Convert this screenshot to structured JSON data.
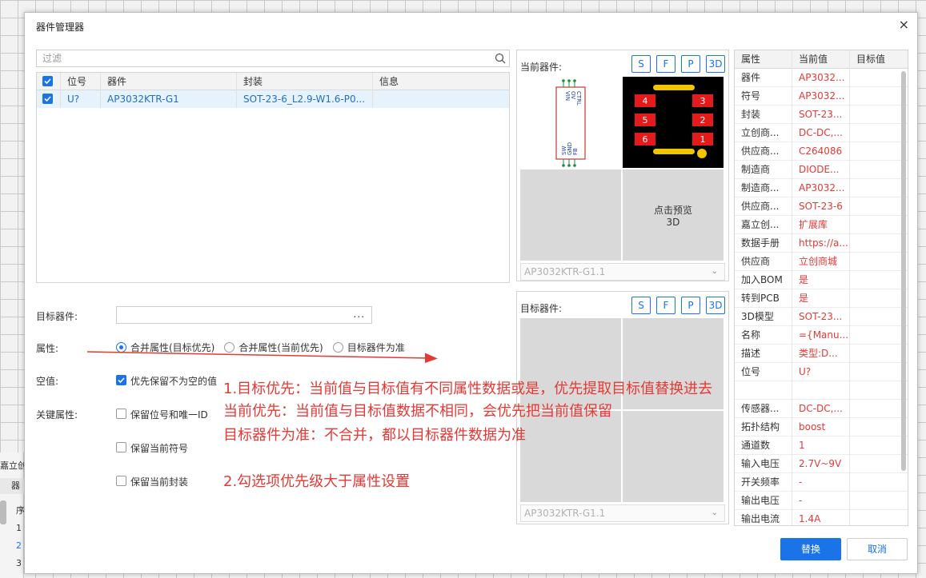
{
  "background": {
    "panel_tab": "嘉立创",
    "sub_header": "器",
    "rows": [
      "序",
      "1",
      "2",
      "3"
    ]
  },
  "dialog": {
    "title": "器件管理器",
    "close": "×"
  },
  "filter": {
    "placeholder": "过滤"
  },
  "parts_table": {
    "headers": [
      "位号",
      "器件",
      "封装",
      "信息"
    ],
    "rows": [
      {
        "checked": true,
        "designator": "U?",
        "device": "AP3032KTR-G1",
        "footprint": "SOT-23-6_L2.9-W1.6-P0...",
        "info": ""
      }
    ]
  },
  "form": {
    "target_label": "目标器件:",
    "target_button": "...",
    "attr_label": "属性:",
    "radios": [
      {
        "label": "合并属性(目标优先)",
        "selected": true
      },
      {
        "label": "合并属性(当前优先)",
        "selected": false
      },
      {
        "label": "目标器件为准",
        "selected": false
      }
    ],
    "empty_label": "空值:",
    "empty_option": "优先保留不为空的值",
    "key_label": "关键属性:",
    "key_options": [
      "保留位号和唯一ID",
      "保留当前符号",
      "保留当前封装"
    ]
  },
  "annotations": {
    "line1": "1.目标优先：当前值与目标值有不同属性数据或是，优先提取目标值替换进去",
    "line2": "当前优先：当前值与目标值数据不相同，会优先把当前值保留",
    "line3": "目标器件为准：不合并，都以目标器件数据为准",
    "line4": "2.勾选项优先级大于属性设置"
  },
  "current_preview": {
    "label": "当前器件:",
    "buttons": [
      "S",
      "F",
      "P",
      "3D"
    ],
    "symbol_pins_top": [
      "VIN",
      "OV",
      "CTRL"
    ],
    "symbol_pins_bottom": [
      "SW",
      "GND",
      "FB"
    ],
    "pad_numbers": [
      "4",
      "3",
      "5",
      "2",
      "6",
      "1"
    ],
    "preview_3d": "点击预览\n3D",
    "select": "AP3032KTR-G1.1"
  },
  "target_preview": {
    "label": "目标器件:",
    "buttons": [
      "S",
      "F",
      "P",
      "3D"
    ],
    "select": "AP3032KTR-G1.1"
  },
  "attr_table": {
    "headers": [
      "属性",
      "当前值",
      "目标值"
    ],
    "rows": [
      [
        "器件",
        "AP3032...",
        ""
      ],
      [
        "符号",
        "AP3032...",
        ""
      ],
      [
        "封装",
        "SOT-23...",
        ""
      ],
      [
        "立创商...",
        "DC-DC,...",
        ""
      ],
      [
        "供应商...",
        "C264086",
        ""
      ],
      [
        "制造商",
        "DIODE...",
        ""
      ],
      [
        "制造商...",
        "AP3032...",
        ""
      ],
      [
        "供应商...",
        "SOT-23-6",
        ""
      ],
      [
        "嘉立创...",
        "扩展库",
        ""
      ],
      [
        "数据手册",
        "https://a...",
        ""
      ],
      [
        "供应商",
        "立创商城",
        ""
      ],
      [
        "加入BOM",
        "是",
        ""
      ],
      [
        "转到PCB",
        "是",
        ""
      ],
      [
        "3D模型",
        "SOT-23...",
        ""
      ],
      [
        "名称",
        "={Manu...",
        ""
      ],
      [
        "描述",
        "类型:D...",
        ""
      ],
      [
        "位号",
        "U?",
        ""
      ],
      [
        "",
        "",
        ""
      ],
      [
        "传感器...",
        "DC-DC,...",
        ""
      ],
      [
        "拓扑结构",
        "boost",
        ""
      ],
      [
        "通道数",
        "1",
        ""
      ],
      [
        "输入电压",
        "2.7V~9V",
        ""
      ],
      [
        "开关频率",
        "-",
        ""
      ],
      [
        "输出电压",
        "-",
        ""
      ],
      [
        "输出电流",
        "1.4A",
        ""
      ]
    ]
  },
  "buttons": {
    "replace": "替换",
    "cancel": "取消"
  },
  "colors": {
    "accent": "#1a73e8",
    "annotation": "#e53935",
    "pad": "#e31b1b",
    "silk": "#f5c400"
  }
}
